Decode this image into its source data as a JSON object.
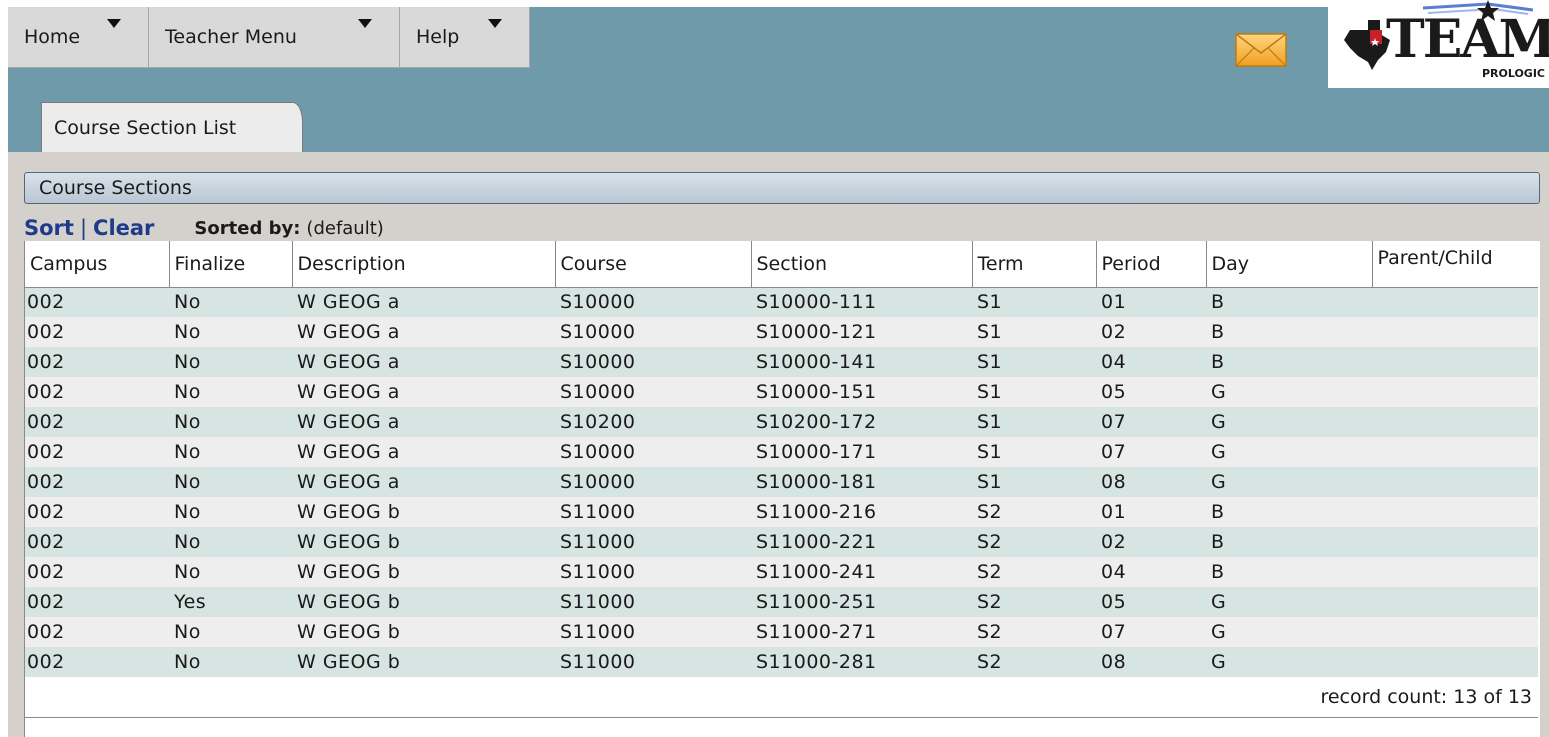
{
  "nav": {
    "home": "Home",
    "teacher_menu": "Teacher Menu",
    "help": "Help"
  },
  "logo": {
    "text": "TEAMS",
    "subtext": "PROLOGIC"
  },
  "tabs": {
    "course_section_list": "Course Section List"
  },
  "section": {
    "title": "Course Sections"
  },
  "sort_bar": {
    "sort": "Sort",
    "separator": "|",
    "clear": "Clear",
    "sorted_by_label": "Sorted by:",
    "sorted_by_value": "(default)"
  },
  "table": {
    "headers": [
      "Campus",
      "Finalize",
      "Description",
      "Course",
      "Section",
      "Term",
      "Period",
      "Day",
      "Parent/Child"
    ],
    "rows": [
      [
        "002",
        "No",
        "W GEOG a",
        "S10000",
        "S10000-111",
        "S1",
        "01",
        "B",
        ""
      ],
      [
        "002",
        "No",
        "W GEOG a",
        "S10000",
        "S10000-121",
        "S1",
        "02",
        "B",
        ""
      ],
      [
        "002",
        "No",
        "W GEOG a",
        "S10000",
        "S10000-141",
        "S1",
        "04",
        "B",
        ""
      ],
      [
        "002",
        "No",
        "W GEOG a",
        "S10000",
        "S10000-151",
        "S1",
        "05",
        "G",
        ""
      ],
      [
        "002",
        "No",
        "W GEOG a",
        "S10200",
        "S10200-172",
        "S1",
        "07",
        "G",
        ""
      ],
      [
        "002",
        "No",
        "W GEOG a",
        "S10000",
        "S10000-171",
        "S1",
        "07",
        "G",
        ""
      ],
      [
        "002",
        "No",
        "W GEOG a",
        "S10000",
        "S10000-181",
        "S1",
        "08",
        "G",
        ""
      ],
      [
        "002",
        "No",
        "W GEOG b",
        "S11000",
        "S11000-216",
        "S2",
        "01",
        "B",
        ""
      ],
      [
        "002",
        "No",
        "W GEOG b",
        "S11000",
        "S11000-221",
        "S2",
        "02",
        "B",
        ""
      ],
      [
        "002",
        "No",
        "W GEOG b",
        "S11000",
        "S11000-241",
        "S2",
        "04",
        "B",
        ""
      ],
      [
        "002",
        "Yes",
        "W GEOG b",
        "S11000",
        "S11000-251",
        "S2",
        "05",
        "G",
        ""
      ],
      [
        "002",
        "No",
        "W GEOG b",
        "S11000",
        "S11000-271",
        "S2",
        "07",
        "G",
        ""
      ],
      [
        "002",
        "No",
        "W GEOG b",
        "S11000",
        "S11000-281",
        "S2",
        "08",
        "G",
        ""
      ]
    ],
    "record_count": "record count: 13 of 13"
  },
  "icons": {
    "mail": "mail-envelope-icon",
    "nav_dropdown": "triangle-down-icon",
    "logo_mark": "texas-flag-star-icon"
  },
  "colors": {
    "header_bg": "#6e9aaa",
    "row_alt": "#d6e4e2",
    "row_plain": "#eeeeee",
    "link_blue": "#1f3a8a",
    "panel_bg": "#d4d1cc"
  }
}
